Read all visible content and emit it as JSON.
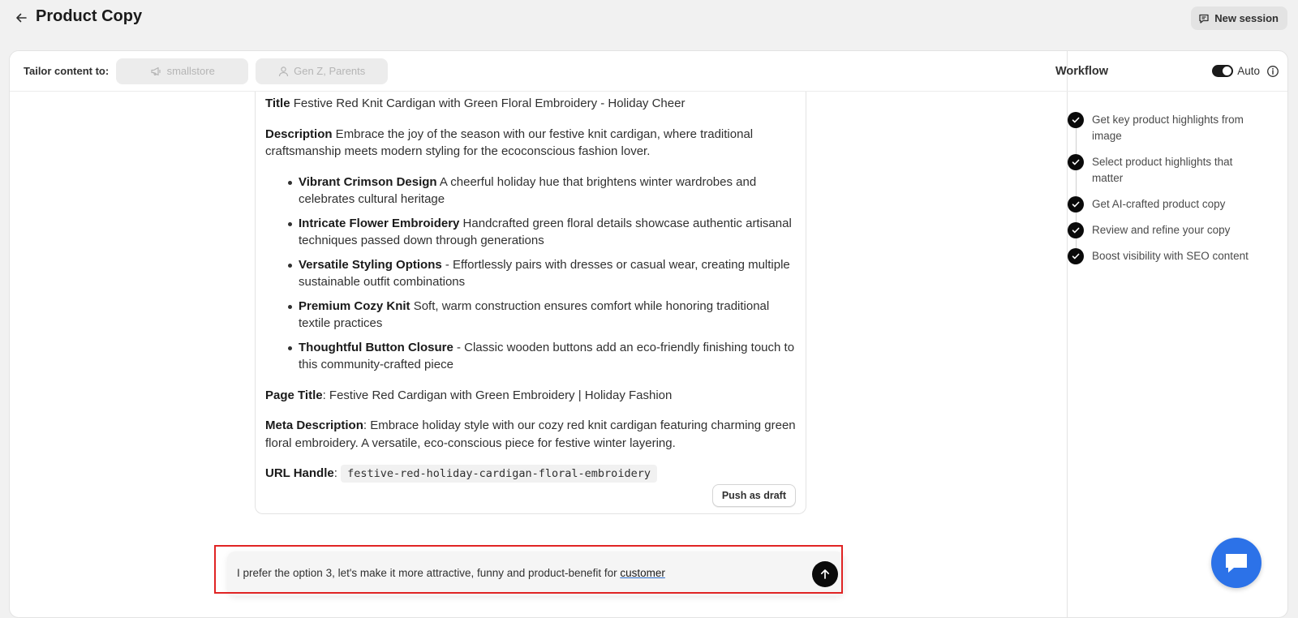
{
  "header": {
    "title": "Product Copy",
    "new_session_label": "New session"
  },
  "tailor": {
    "label": "Tailor content to:",
    "chips": [
      "smallstore",
      "Gen Z, Parents"
    ]
  },
  "result": {
    "title_label": "Title",
    "title_value": " Festive Red Knit Cardigan with Green Floral Embroidery - Holiday Cheer",
    "description_label": "Description",
    "description_value": " Embrace the joy of the season with our festive knit cardigan, where traditional craftsmanship meets modern styling for the ecoconscious fashion lover.",
    "bullets": [
      {
        "head": "Vibrant Crimson Design",
        "text": " A cheerful holiday hue that brightens winter wardrobes and celebrates cultural heritage"
      },
      {
        "head": "Intricate Flower Embroidery",
        "text": " Handcrafted green floral details showcase authentic artisanal techniques passed down through generations"
      },
      {
        "head": "Versatile Styling Options",
        "text": " - Effortlessly pairs with dresses or casual wear, creating multiple sustainable outfit combinations"
      },
      {
        "head": "Premium Cozy Knit",
        "text": " Soft, warm construction ensures comfort while honoring traditional textile practices"
      },
      {
        "head": "Thoughtful Button Closure",
        "text": " - Classic wooden buttons add an eco-friendly finishing touch to this community-crafted piece"
      }
    ],
    "page_title_label": "Page Title",
    "page_title_value": ": Festive Red Cardigan with Green Embroidery | Holiday Fashion",
    "meta_label": "Meta Description",
    "meta_value": ": Embrace holiday style with our cozy red knit cardigan featuring charming green floral embroidery. A versatile, eco-conscious piece for festive winter layering.",
    "url_label": "URL Handle",
    "url_sep": ": ",
    "url_value": "festive-red-holiday-cardigan-floral-embroidery",
    "push_label": "Push as draft"
  },
  "chat": {
    "text_main": "I prefer the option 3, let's make it more attractive, funny and product-benefit for ",
    "text_underlined": "customer"
  },
  "workflow": {
    "title": "Workflow",
    "auto_label": "Auto",
    "auto_on": true,
    "steps": [
      "Get key product highlights from image",
      "Select product highlights that matter",
      "Get AI-crafted product copy",
      "Review and refine your copy",
      "Boost visibility with SEO content"
    ]
  },
  "colors": {
    "accent": "#2c72e8",
    "highlight": "#e02424"
  },
  "icons": {
    "back": "arrow-left-icon",
    "new_session": "chat-icon",
    "chip_store": "megaphone-icon",
    "chip_audience": "person-icon",
    "info": "info-icon",
    "send": "arrow-up-icon",
    "step": "check-icon",
    "support": "chat-bubble-icon"
  }
}
